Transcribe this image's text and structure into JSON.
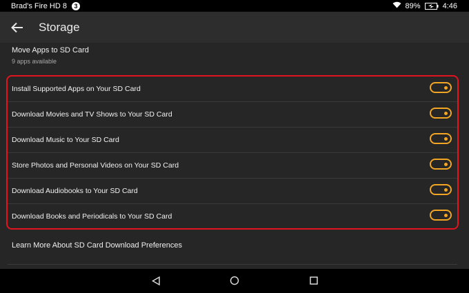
{
  "status_bar": {
    "device_name": "Brad's Fire HD 8",
    "notification_count": "3",
    "battery_percent": "89%",
    "time": "4:46",
    "icons": [
      "wifi-icon",
      "battery-charging-icon"
    ]
  },
  "header": {
    "title": "Storage",
    "back_icon": "back-arrow-icon"
  },
  "move_apps": {
    "title": "Move Apps to SD Card",
    "subtitle": "9 apps available"
  },
  "toggle_rows": [
    {
      "label": "Install Supported Apps on Your SD Card",
      "on": true
    },
    {
      "label": "Download Movies and TV Shows to Your SD Card",
      "on": true
    },
    {
      "label": "Download Music to Your SD Card",
      "on": true
    },
    {
      "label": "Store Photos and Personal Videos on Your SD Card",
      "on": true
    },
    {
      "label": "Download Audiobooks to Your SD Card",
      "on": true
    },
    {
      "label": "Download Books and Periodicals to Your SD Card",
      "on": true
    }
  ],
  "learn_more": "Learn More About SD Card Download Preferences",
  "nav": {
    "icons": [
      "nav-back-icon",
      "nav-home-icon",
      "nav-recents-icon"
    ]
  },
  "colors": {
    "accent_toggle": "#f2a623",
    "highlight_border": "#e3141f",
    "background": "#262626",
    "app_bar": "#2d2d2d"
  }
}
